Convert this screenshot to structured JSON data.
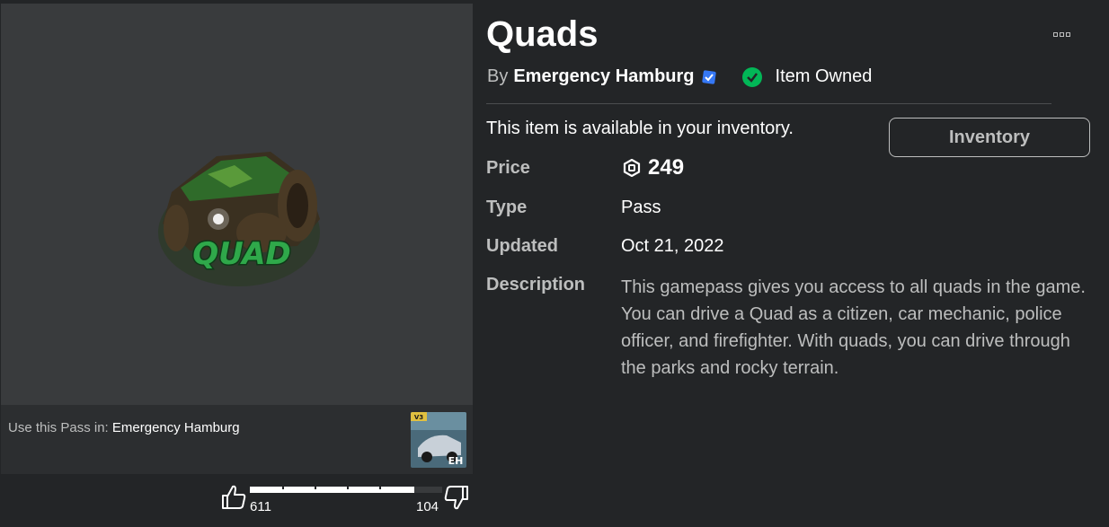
{
  "item": {
    "title": "Quads",
    "by_prefix": "By",
    "creator": "Emergency Hamburg",
    "owned_label": "Item Owned",
    "availability": "This item is available in your inventory.",
    "inventory_button": "Inventory"
  },
  "details": {
    "price_label": "Price",
    "price_value": "249",
    "type_label": "Type",
    "type_value": "Pass",
    "updated_label": "Updated",
    "updated_value": "Oct 21, 2022",
    "description_label": "Description",
    "description_value": "This gamepass gives you access to all quads in the game. You can drive a Quad as a citizen, car mechanic, police officer, and firefighter. With quads, you can drive through the parks and rocky terrain."
  },
  "thumbnail": {
    "art_text": "QUAD",
    "use_prefix": "Use this Pass in:",
    "game_name": "Emergency Hamburg",
    "game_badge": "V3",
    "game_initials": "EH"
  },
  "votes": {
    "up": "611",
    "down": "104",
    "up_fraction": 0.855
  },
  "colors": {
    "background": "#232527",
    "panel": "#393b3d",
    "verified": "#3578f6",
    "owned": "#02b757"
  },
  "icons": [
    "more-options-icon",
    "verified-badge-icon",
    "check-circle-icon",
    "robux-icon",
    "thumbs-up-icon",
    "thumbs-down-icon"
  ]
}
